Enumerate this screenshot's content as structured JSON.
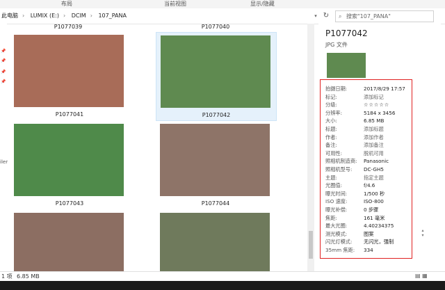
{
  "ribbon": {
    "labels": [
      "布局",
      "当前视图",
      "显示/隐藏"
    ]
  },
  "address": {
    "crumbs": [
      "此电脑",
      "LUMIX (E:)",
      "DCIM",
      "107_PANA"
    ],
    "search_placeholder": "搜索\"107_PANA\""
  },
  "left": {
    "truncated_label": "iler"
  },
  "grid": {
    "top_captions": [
      "P1077039",
      "P1077040"
    ],
    "items": [
      {
        "name": "P1077041",
        "selected": false
      },
      {
        "name": "P1077042",
        "selected": true
      },
      {
        "name": "P1077043",
        "selected": false
      },
      {
        "name": "P1077044",
        "selected": false
      },
      {
        "name": "",
        "selected": false
      },
      {
        "name": "",
        "selected": false
      }
    ]
  },
  "details": {
    "title": "P1077042",
    "type": "JPG 文件",
    "props": [
      {
        "k": "拍摄日期:",
        "v": "2017/8/29 17:57"
      },
      {
        "k": "标记:",
        "v": "添加标记",
        "ph": true
      },
      {
        "k": "分级:",
        "v": "☆☆☆☆☆",
        "stars": true
      },
      {
        "k": "分辨率:",
        "v": "5184 x 3456"
      },
      {
        "k": "大小:",
        "v": "6.85 MB"
      },
      {
        "k": "标题:",
        "v": "添加标题",
        "ph": true
      },
      {
        "k": "作者:",
        "v": "添加作者",
        "ph": true
      },
      {
        "k": "备注:",
        "v": "添加备注",
        "ph": true
      },
      {
        "k": "可用性:",
        "v": "脱机可用",
        "ph": true
      },
      {
        "k": "照相机制造商:",
        "v": "Panasonic"
      },
      {
        "k": "照相机型号:",
        "v": "DC-GH5"
      },
      {
        "k": "主题:",
        "v": "指定主题",
        "ph": true
      },
      {
        "k": "光圈值:",
        "v": "f/4.6"
      },
      {
        "k": "曝光时间:",
        "v": "1/500 秒"
      },
      {
        "k": "ISO 速度:",
        "v": "ISO-800"
      },
      {
        "k": "曝光补偿:",
        "v": "0 步骤"
      },
      {
        "k": "焦距:",
        "v": "161 毫米"
      },
      {
        "k": "最大光圈:",
        "v": "4.40234375"
      },
      {
        "k": "测光模式:",
        "v": "图案"
      },
      {
        "k": "闪光灯模式:",
        "v": "无闪光，强制"
      },
      {
        "k": "35mm 焦距:",
        "v": "334"
      }
    ]
  },
  "status": {
    "left": "1 项",
    "size": "6.85 MB"
  },
  "colors": {
    "accent_selection": "#e5f1fb",
    "highlight_border": "#e02020"
  }
}
